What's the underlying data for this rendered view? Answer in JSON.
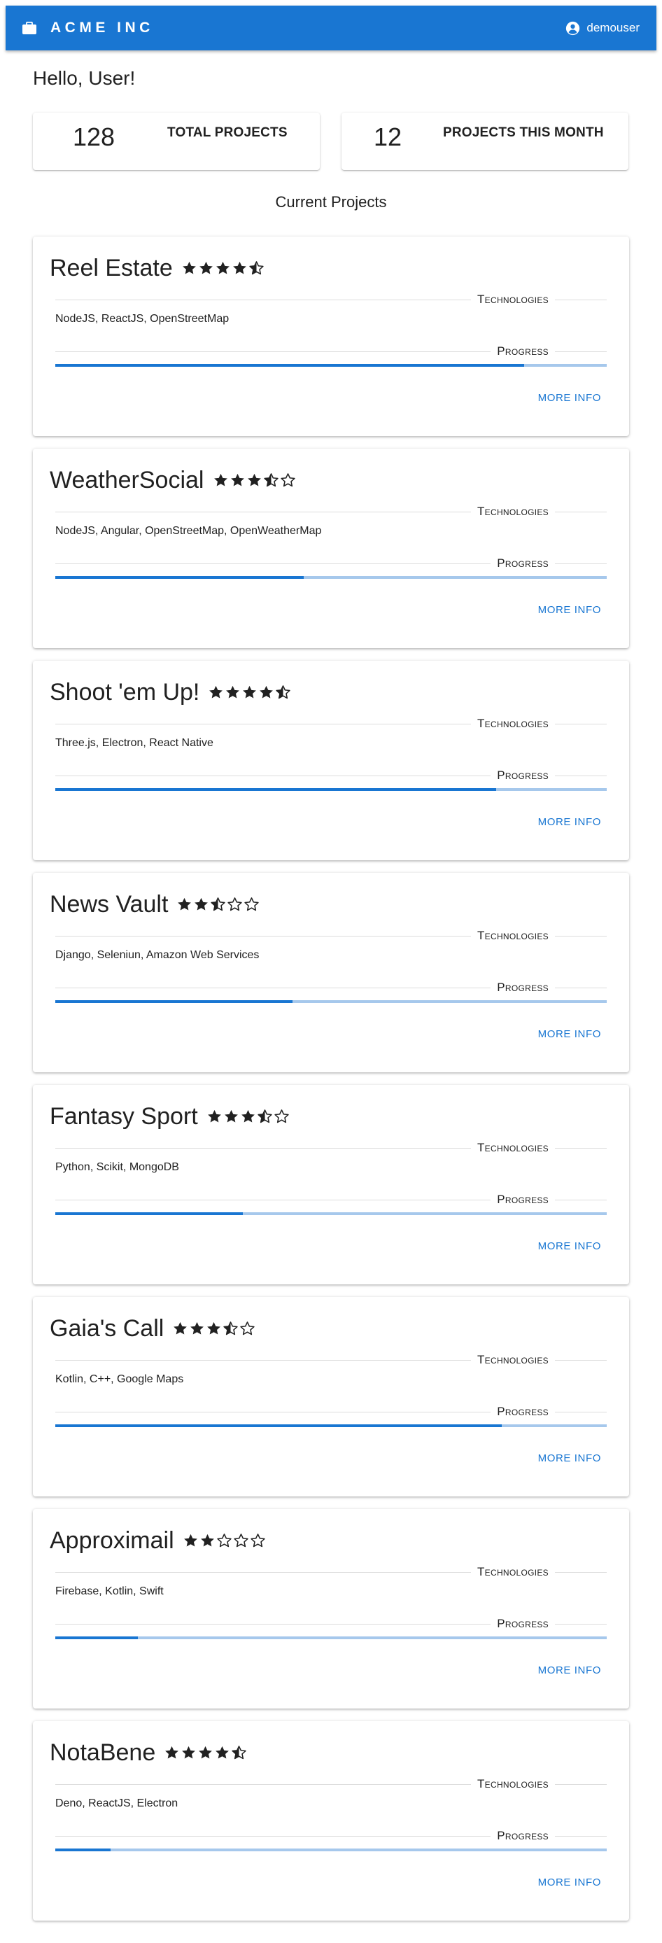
{
  "header": {
    "brand": "ACME INC",
    "user": "demouser",
    "brand_icon": "briefcase-icon",
    "user_icon": "account-circle-icon",
    "color": "#1976d2"
  },
  "greeting": "Hello, User!",
  "stats": [
    {
      "value": "128",
      "label": "TOTAL PROJECTS"
    },
    {
      "value": "12",
      "label": "PROJECTS THIS MONTH"
    }
  ],
  "section_title": "Current Projects",
  "labels": {
    "technologies": "Technologies",
    "progress": "Progress",
    "more_info": "MORE INFO"
  },
  "projects": [
    {
      "title": "Reel Estate",
      "rating": 4.5,
      "technologies": "NodeJS, ReactJS, OpenStreetMap",
      "progress": 0.85
    },
    {
      "title": "WeatherSocial",
      "rating": 3.5,
      "technologies": "NodeJS, Angular, OpenStreetMap, OpenWeatherMap",
      "progress": 0.45
    },
    {
      "title": "Shoot 'em Up!",
      "rating": 4.5,
      "technologies": "Three.js, Electron, React Native",
      "progress": 0.8
    },
    {
      "title": "News Vault",
      "rating": 2.5,
      "technologies": "Django, Seleniun, Amazon Web Services",
      "progress": 0.43
    },
    {
      "title": "Fantasy Sport",
      "rating": 3.5,
      "technologies": "Python, Scikit, MongoDB",
      "progress": 0.34
    },
    {
      "title": "Gaia's Call",
      "rating": 3.5,
      "technologies": "Kotlin, C++, Google Maps",
      "progress": 0.81
    },
    {
      "title": "Approximail",
      "rating": 2,
      "technologies": "Firebase, Kotlin, Swift",
      "progress": 0.15
    },
    {
      "title": "NotaBene",
      "rating": 4.5,
      "technologies": "Deno, ReactJS, Electron",
      "progress": 0.1
    }
  ]
}
